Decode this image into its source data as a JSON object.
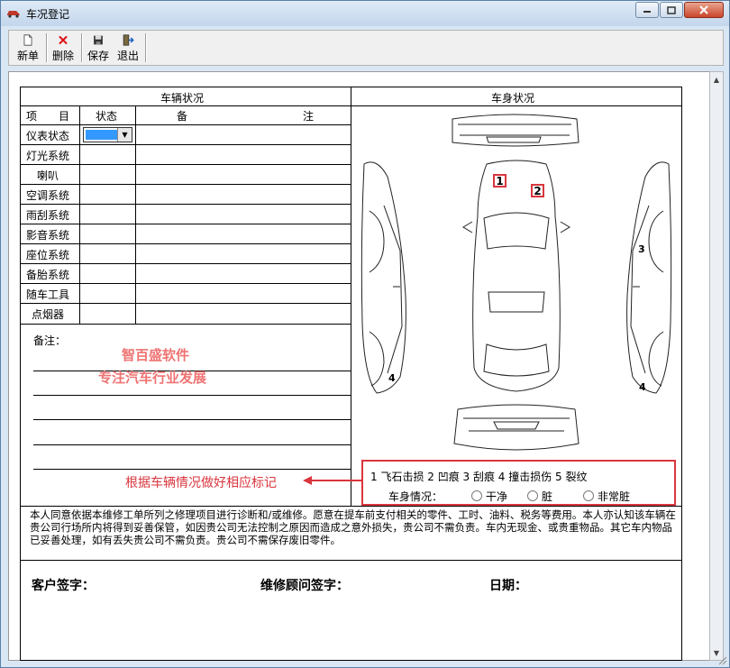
{
  "window": {
    "title": "车况登记"
  },
  "toolbar": {
    "new_label": "新单",
    "delete_label": "删除",
    "save_label": "保存",
    "exit_label": "退出"
  },
  "left_panel": {
    "title": "车辆状况",
    "col_item": "项　　目",
    "col_status": "状态",
    "col_note_a": "备",
    "col_note_b": "注",
    "rows": [
      "仪表状态",
      "灯光系统",
      "喇叭",
      "空调系统",
      "雨刮系统",
      "影音系统",
      "座位系统",
      "备胎系统",
      "随车工具",
      "点烟器"
    ]
  },
  "remarks": {
    "label": "备注："
  },
  "watermark": {
    "line1": "智百盛软件",
    "line2": "专注汽车行业发展"
  },
  "right_panel": {
    "title": "车身状况"
  },
  "diagram_marks": {
    "m1": "1",
    "m2": "2",
    "m3": "3",
    "m4a": "4",
    "m4b": "4"
  },
  "annotation": {
    "text": "根据车辆情况做好相应标记"
  },
  "legend": {
    "types": "1  飞石击损    2  凹痕    3  刮痕    4  撞击损伤    5  裂纹",
    "condition_label": "车身情况：",
    "options": [
      "干净",
      "脏",
      "非常脏"
    ]
  },
  "disclaimer": {
    "text": "本人同意依据本维修工单所列之修理项目进行诊断和/或维修。愿意在提车前支付相关的零件、工时、油料、税务等费用。本人亦认知该车辆在贵公司行场所内将得到妥善保管，如因贵公司无法控制之原因而造成之意外损失，贵公司不需负责。车内无现金、或贵重物品。其它车内物品已妥善处理，如有丢失贵公司不需负责。贵公司不需保存废旧零件。"
  },
  "signatures": {
    "customer": "客户签字：",
    "advisor": "维修顾问签字：",
    "date": "日期："
  },
  "colors": {
    "accent_red": "#d9363e",
    "watermark": "#ef7373",
    "select_blue": "#3399ff"
  }
}
